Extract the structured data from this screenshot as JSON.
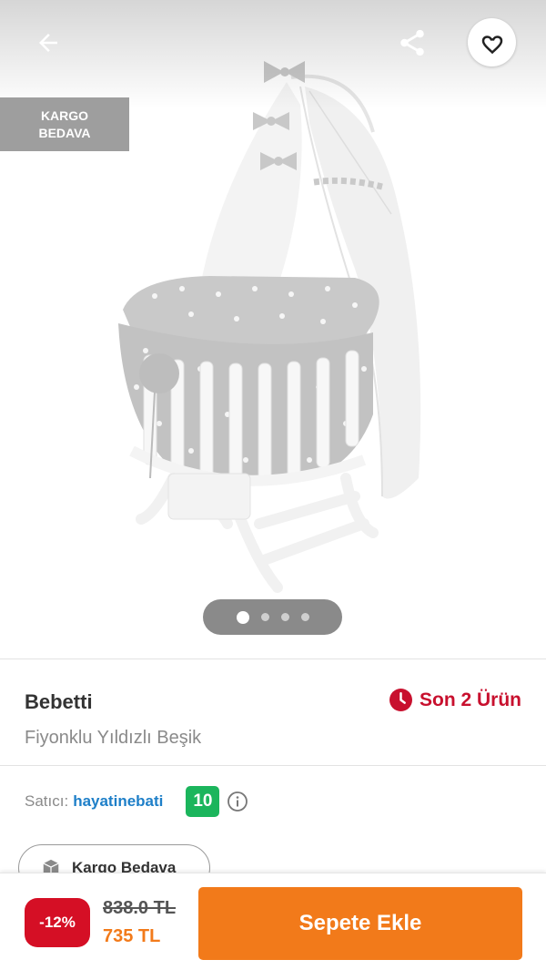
{
  "gallery": {
    "badge_line1": "KARGO",
    "badge_line2": "BEDAVA",
    "image_count": 4,
    "active_index": 0,
    "icons": {
      "back": "arrow-left-icon",
      "share": "share-icon",
      "favorite": "heart-outline-icon"
    }
  },
  "product": {
    "brand": "Bebetti",
    "name": "Fiyonklu Yıldızlı Beşik",
    "stock_text": "Son 2 Ürün",
    "stock_icon": "clock-icon"
  },
  "seller": {
    "label": "Satıcı:",
    "name": "hayatinebati",
    "rating": "10",
    "info_icon": "info-icon"
  },
  "shipping_chip": {
    "label": "Kargo Bedava",
    "icon": "box-icon"
  },
  "bottom_bar": {
    "discount": "-12%",
    "old_price": "838.0 TL",
    "new_price": "735 TL",
    "add_to_cart": "Sepete Ekle"
  },
  "colors": {
    "accent": "#f27a1a",
    "discount_red": "#d50f25",
    "stock_red": "#c8102e",
    "seller_blue": "#1e7fc8",
    "rating_green": "#1bb55c",
    "badge_gray": "#9e9e9e"
  }
}
